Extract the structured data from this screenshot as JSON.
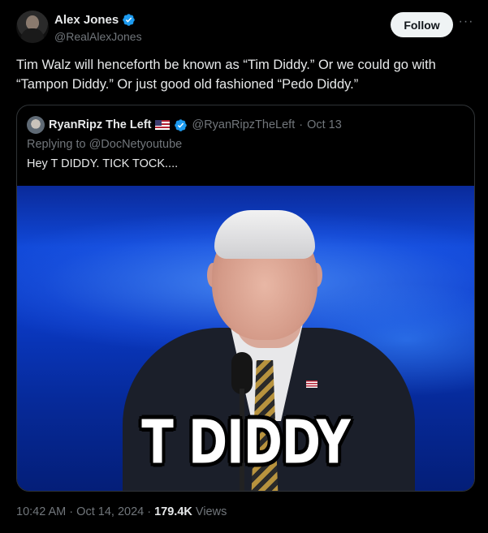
{
  "author": {
    "name": "Alex Jones",
    "handle": "@RealAlexJones"
  },
  "actions": {
    "follow_label": "Follow",
    "more_label": "···"
  },
  "tweet": {
    "text": "Tim Walz will henceforth be known as “Tim Diddy.” Or we could go with “Tampon Diddy.” Or just good old fashioned “Pedo Diddy.”"
  },
  "quote": {
    "name": "RyanRipz The Left",
    "handle": "@RyanRipzTheLeft",
    "separator": "·",
    "date": "Oct 13",
    "replying_to": "Replying to @DocNetyoutube",
    "text": "Hey T DIDDY. TICK TOCK....",
    "media_caption": "T DIDDY"
  },
  "footer": {
    "time": "10:42 AM",
    "sep1": "·",
    "date": "Oct 14, 2024",
    "sep2": "·",
    "views_count": "179.4K",
    "views_label": "Views"
  },
  "colors": {
    "verified": "#1d9bf0",
    "background": "#000000",
    "muted": "#71767b"
  }
}
